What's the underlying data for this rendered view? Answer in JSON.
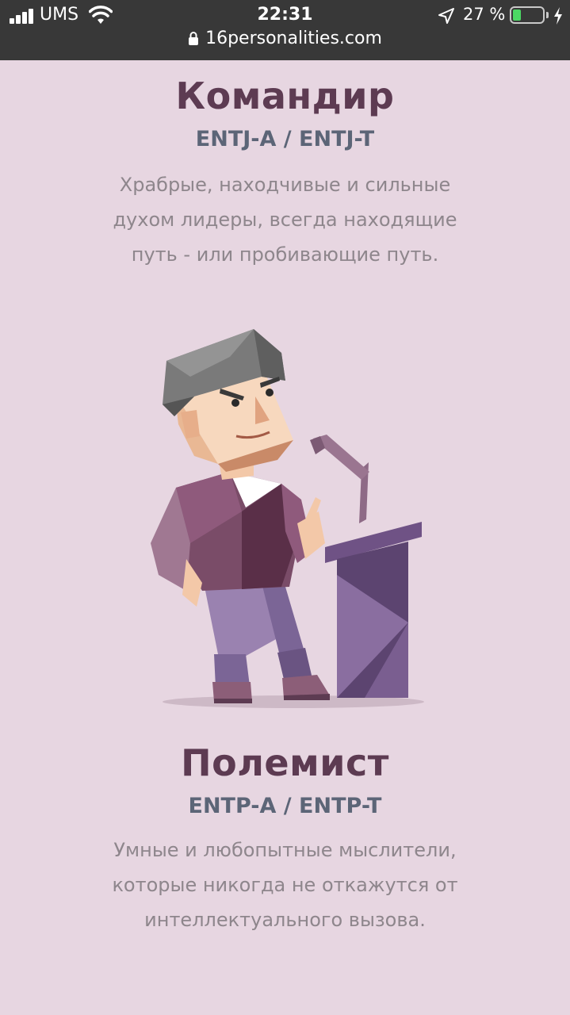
{
  "status_bar": {
    "carrier": "UMS",
    "time": "22:31",
    "battery_percent": "27 %",
    "battery_level": 0.27,
    "url": "16personalities.com"
  },
  "cards": [
    {
      "title": "Командир",
      "codes": "ENTJ-A / ENTJ-T",
      "description": "Храбрые, находчивые и сильные духом лидеры, всегда находящие путь - или пробивающие путь."
    },
    {
      "title": "Полемист",
      "codes": "ENTP-A / ENTP-T",
      "description": "Умные и любопытные мыслители, которые никогда не откажутся от интеллектуального вызова."
    }
  ],
  "illustration": {
    "icon": "commander-character-illustration",
    "colors": {
      "hair": "#7a7a7a",
      "skin": "#f3c8a8",
      "shirt": "#8f5a7c",
      "pants": "#9a82b0",
      "podium": "#6f5285"
    }
  }
}
